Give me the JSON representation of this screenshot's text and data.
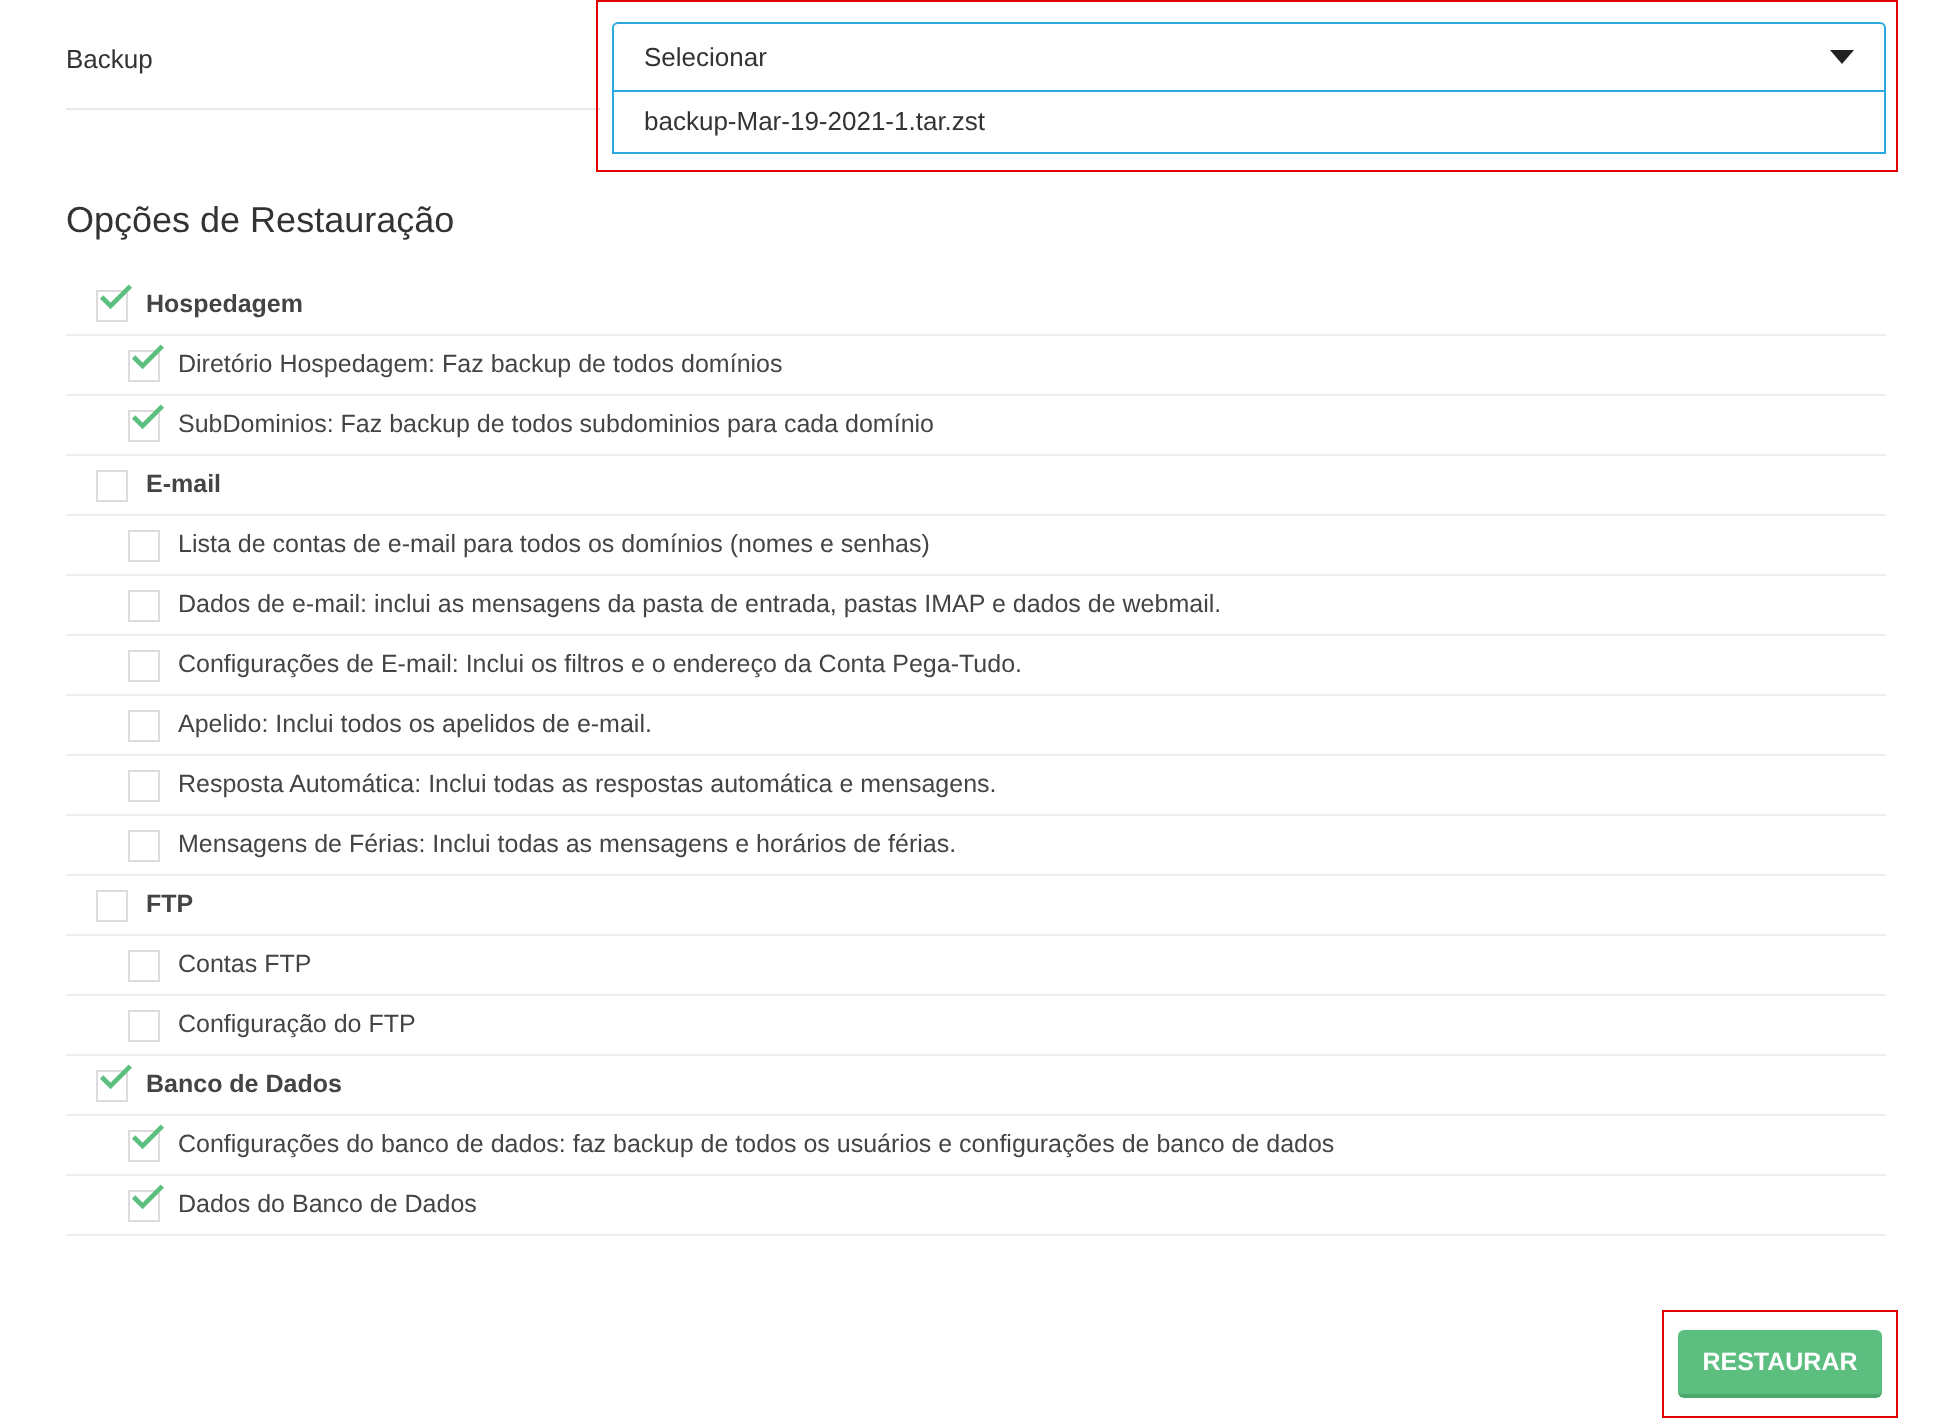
{
  "backup": {
    "label": "Backup",
    "select": {
      "value": "Selecionar",
      "expanded": true,
      "options": [
        {
          "label": "backup-Mar-19-2021-1.tar.zst",
          "selected": false
        }
      ]
    }
  },
  "heading": "Opções de Restauração",
  "groups": [
    {
      "label": "Hospedagem",
      "checked": true,
      "children": [
        {
          "label": "Diretório Hospedagem: Faz backup de todos domínios",
          "checked": true
        },
        {
          "label": "SubDominios: Faz backup de todos subdominios para cada domínio",
          "checked": true
        }
      ]
    },
    {
      "label": "E-mail",
      "checked": false,
      "children": [
        {
          "label": "Lista de contas de e-mail para todos os domínios (nomes e senhas)",
          "checked": false
        },
        {
          "label": "Dados de e-mail: inclui as mensagens da pasta de entrada, pastas IMAP e dados de webmail.",
          "checked": false
        },
        {
          "label": "Configurações de E-mail: Inclui os filtros e o endereço da Conta Pega-Tudo.",
          "checked": false
        },
        {
          "label": "Apelido: Inclui todos os apelidos de e-mail.",
          "checked": false
        },
        {
          "label": "Resposta Automática: Inclui todas as respostas automática e mensagens.",
          "checked": false
        },
        {
          "label": "Mensagens de Férias: Inclui todas as mensagens e horários de férias.",
          "checked": false
        }
      ]
    },
    {
      "label": "FTP",
      "checked": false,
      "children": [
        {
          "label": "Contas FTP",
          "checked": false
        },
        {
          "label": "Configuração do FTP",
          "checked": false
        }
      ]
    },
    {
      "label": "Banco de Dados",
      "checked": true,
      "children": [
        {
          "label": "Configurações do banco de dados: faz backup de todos os usuários e configurações de banco de dados",
          "checked": true
        },
        {
          "label": "Dados do Banco de Dados",
          "checked": true
        }
      ]
    }
  ],
  "restore_button": "RESTAURAR"
}
